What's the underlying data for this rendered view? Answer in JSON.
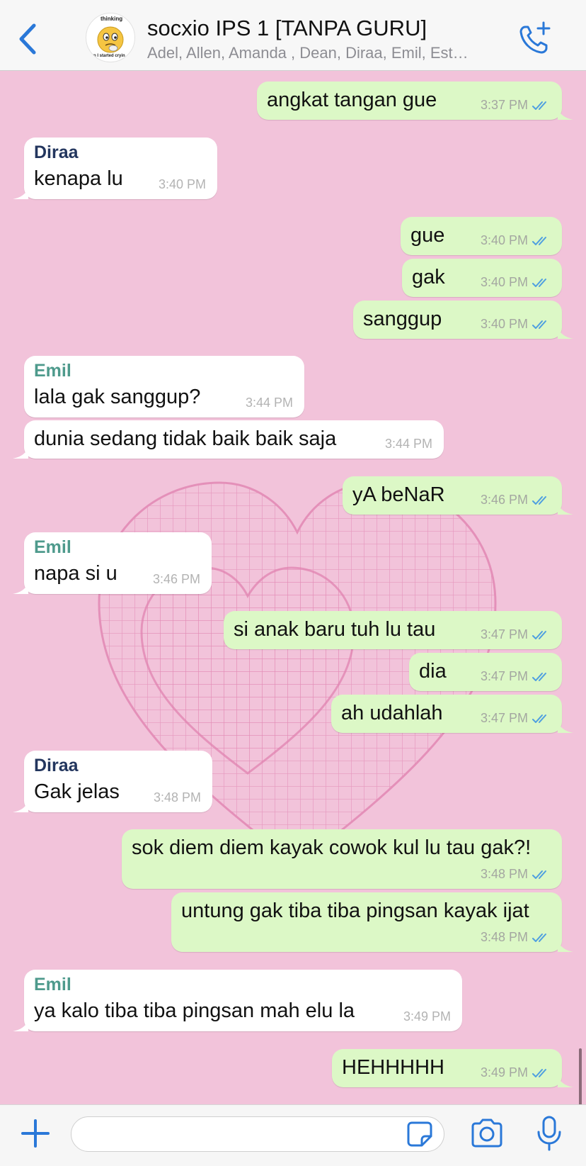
{
  "header": {
    "title": "socxio IPS 1 [TANPA GURU]",
    "subtitle": "Adel, Allen, Amanda , Dean, Diraa, Emil, Est…",
    "avatar_top_text": "thinking",
    "avatar_bottom_text": "n I started cryin"
  },
  "colors": {
    "accent": "#2a78d8",
    "outgoing_bubble": "#dcf8c6",
    "incoming_bubble": "#ffffff",
    "chat_background": "#f2c3da",
    "sender_diraa": "#23365e",
    "sender_emil": "#4e9a8c",
    "read_ticks": "#4f9fe0"
  },
  "messages": [
    {
      "text": "angkat tangan gue",
      "time": "3:37 PM",
      "dir": "out"
    },
    {
      "sender": "Diraa",
      "text": "kenapa lu",
      "time": "3:40 PM",
      "dir": "in"
    },
    {
      "text": "gue",
      "time": "3:40 PM",
      "dir": "out"
    },
    {
      "text": "gak",
      "time": "3:40 PM",
      "dir": "out"
    },
    {
      "text": "sanggup",
      "time": "3:40 PM",
      "dir": "out"
    },
    {
      "sender": "Emil",
      "text": "lala gak sanggup?",
      "time": "3:44 PM",
      "dir": "in"
    },
    {
      "text": "dunia sedang tidak baik baik saja",
      "time": "3:44 PM",
      "dir": "in"
    },
    {
      "text": "yA beNaR",
      "time": "3:46 PM",
      "dir": "out"
    },
    {
      "sender": "Emil",
      "text": "napa si u",
      "time": "3:46 PM",
      "dir": "in"
    },
    {
      "text": "si anak baru tuh lu tau",
      "time": "3:47 PM",
      "dir": "out"
    },
    {
      "text": "dia",
      "time": "3:47 PM",
      "dir": "out"
    },
    {
      "text": "ah udahlah",
      "time": "3:47 PM",
      "dir": "out"
    },
    {
      "sender": "Diraa",
      "text": "Gak jelas",
      "time": "3:48 PM",
      "dir": "in"
    },
    {
      "text": "sok diem diem kayak cowok kul lu tau gak?!",
      "time": "3:48 PM",
      "dir": "out"
    },
    {
      "text": "untung gak tiba tiba pingsan kayak ijat",
      "time": "3:48 PM",
      "dir": "out"
    },
    {
      "sender": "Emil",
      "text": "ya kalo tiba tiba pingsan mah elu la",
      "time": "3:49 PM",
      "dir": "in"
    },
    {
      "text": "HEHHHHH",
      "time": "3:49 PM",
      "dir": "out"
    }
  ],
  "input": {
    "value": "",
    "placeholder": ""
  },
  "icons": {
    "back": "chevron-left-icon",
    "call": "phone-plus-icon",
    "plus": "plus-icon",
    "sticker": "sticker-icon",
    "camera": "camera-icon",
    "mic": "microphone-icon"
  }
}
